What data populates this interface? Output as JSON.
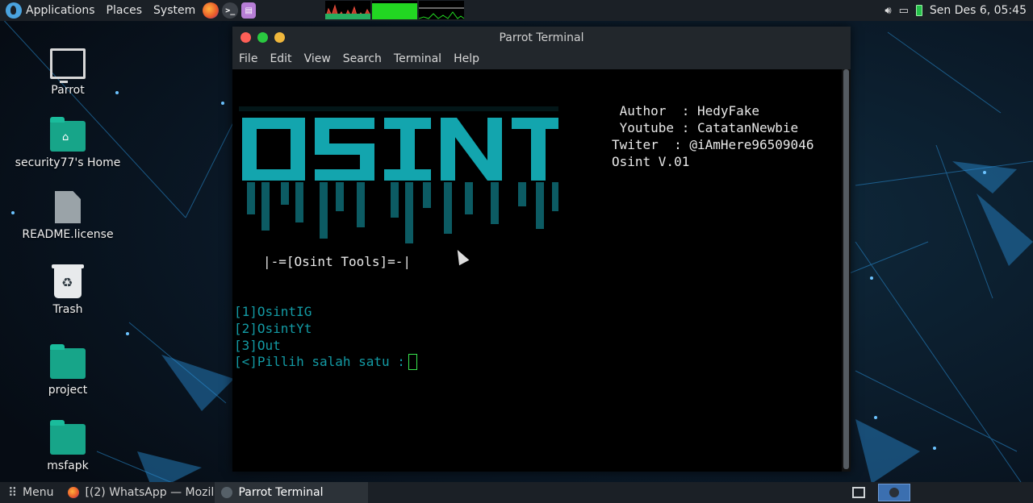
{
  "top_panel": {
    "applications": "Applications",
    "places": "Places",
    "system": "System",
    "launchers": [
      "firefox-icon",
      "terminal-icon",
      "notes-icon"
    ],
    "clock": "Sen Des  6, 05:45"
  },
  "desktop_icons": [
    {
      "label": "Parrot",
      "icon": "computer-icon"
    },
    {
      "label": "security77's Home",
      "icon": "home-folder-icon"
    },
    {
      "label": "README.license",
      "icon": "file-icon"
    },
    {
      "label": "Trash",
      "icon": "trash-icon"
    },
    {
      "label": "project",
      "icon": "folder-icon"
    },
    {
      "label": "msfapk",
      "icon": "folder-icon"
    }
  ],
  "window": {
    "title": "Parrot Terminal",
    "menu": [
      "File",
      "Edit",
      "View",
      "Search",
      "Terminal",
      "Help"
    ]
  },
  "terminal": {
    "info": [
      " Author  : HedyFake",
      " Youtube : CatatanNewbie",
      "Twiter  : @iAmHere96509046",
      "Osint V.01"
    ],
    "banner_word": "OSINT",
    "tools_line": "|-=[Osint Tools]=-|",
    "options": [
      "[1]OsintIG",
      "[2]OsintYt",
      "[3]Out"
    ],
    "prompt": "[<]Pillih salah satu :"
  },
  "bottom_panel": {
    "menu": "Menu",
    "tasks": [
      "[(2) WhatsApp — Mozill...",
      "Parrot Terminal"
    ]
  },
  "colors": {
    "banner": "#139aa4",
    "prompt_text": "#139aa4",
    "cursor": "#39e64f",
    "panel": "#1b2026"
  }
}
